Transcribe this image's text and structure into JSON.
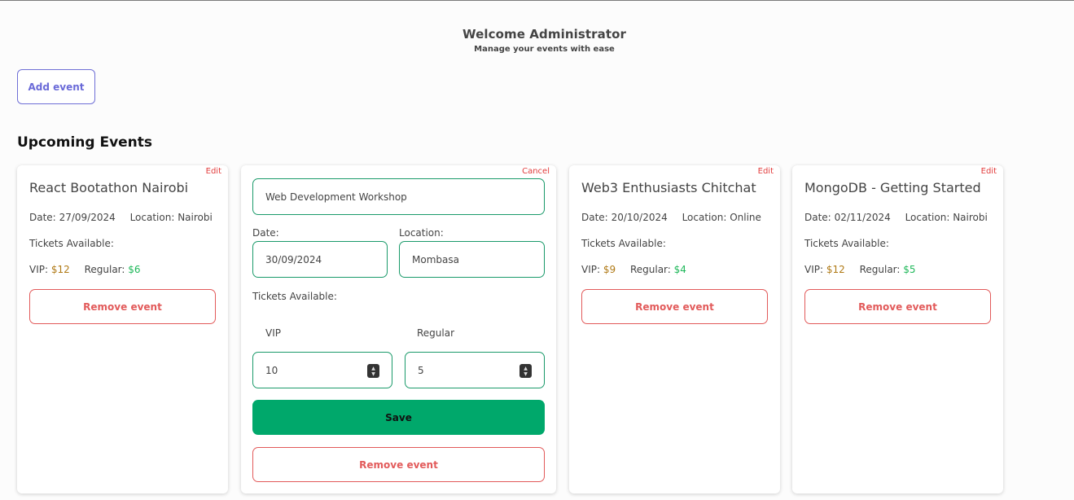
{
  "header": {
    "title": "Welcome Administrator",
    "subtitle": "Manage your events with ease"
  },
  "toolbar": {
    "add_event_label": "Add event"
  },
  "section": {
    "title": "Upcoming Events"
  },
  "labels": {
    "date_prefix": "Date:",
    "location_prefix": "Location:",
    "tickets_available": "Tickets Available:",
    "vip": "VIP:",
    "regular": "Regular:",
    "edit": "Edit",
    "cancel": "Cancel",
    "remove_event": "Remove event",
    "save": "Save"
  },
  "events": [
    {
      "title": "React Bootathon Nairobi",
      "date": "27/09/2024",
      "location": "Nairobi",
      "vip_price": "$12",
      "regular_price": "$6"
    },
    {
      "title": "Web3 Enthusiasts Chitchat",
      "date": "20/10/2024",
      "location": "Online",
      "vip_price": "$9",
      "regular_price": "$4"
    },
    {
      "title": "MongoDB - Getting Started",
      "date": "02/11/2024",
      "location": "Nairobi",
      "vip_price": "$12",
      "regular_price": "$5"
    }
  ],
  "edit_form": {
    "title_value": "Web Development Workshop",
    "date_label": "Date:",
    "date_value": "30/09/2024",
    "location_label": "Location:",
    "location_value": "Mombasa",
    "tickets_label": "Tickets Available:",
    "vip_label": "VIP",
    "regular_label": "Regular",
    "vip_value": "10",
    "regular_value": "5"
  },
  "icons": {
    "spinner_up": "chevron-up-icon",
    "spinner_down": "chevron-down-icon"
  },
  "colors": {
    "accent": "#6a6ad8",
    "danger": "#e25a5a",
    "save": "#00a86b",
    "field_border": "#1a9a6a",
    "vip": "#b07a16",
    "regular": "#1fb85a"
  }
}
